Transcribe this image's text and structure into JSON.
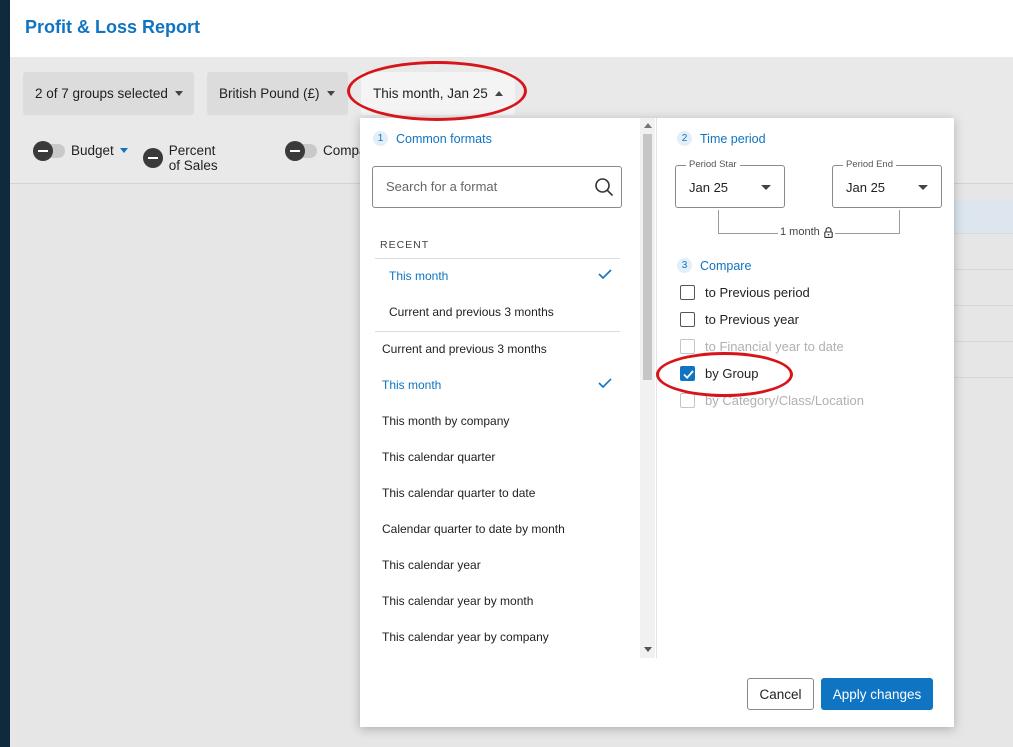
{
  "header": {
    "title": "Profit & Loss Report"
  },
  "filters": {
    "groups": "2 of 7 groups selected",
    "currency": "British Pound (£)",
    "period": "This month, Jan 25"
  },
  "toggles": [
    {
      "label": "Budget"
    },
    {
      "label": "Percent of Sales"
    },
    {
      "label": "Compa"
    }
  ],
  "panel": {
    "common_formats": {
      "number": "1",
      "title": "Common formats"
    },
    "search_placeholder": "Search for a format",
    "recent_label": "RECENT",
    "recent_items": [
      {
        "label": "This month",
        "selected": true
      },
      {
        "label": "Current and previous 3 months",
        "selected": false
      }
    ],
    "items": [
      {
        "label": "Current and previous 3 months",
        "selected": false
      },
      {
        "label": "This month",
        "selected": true
      },
      {
        "label": "This month by company",
        "selected": false
      },
      {
        "label": "This calendar quarter",
        "selected": false
      },
      {
        "label": "This calendar quarter to date",
        "selected": false
      },
      {
        "label": "Calendar quarter to date by month",
        "selected": false
      },
      {
        "label": "This calendar year",
        "selected": false
      },
      {
        "label": "This calendar year by month",
        "selected": false
      },
      {
        "label": "This calendar year by company",
        "selected": false
      }
    ],
    "time_period": {
      "number": "2",
      "title": "Time period",
      "start_label": "Period Star",
      "start_value": "Jan 25",
      "end_label": "Period End",
      "end_value": "Jan 25",
      "duration": "1 month"
    },
    "compare": {
      "number": "3",
      "title": "Compare",
      "options": [
        {
          "label": "to Previous period",
          "checked": false,
          "disabled": false
        },
        {
          "label": "to Previous year",
          "checked": false,
          "disabled": false
        },
        {
          "label": "to Financial year to date",
          "checked": false,
          "disabled": true
        },
        {
          "label": "by Group",
          "checked": true,
          "disabled": false
        },
        {
          "label": "by Category/Class/Location",
          "checked": false,
          "disabled": true
        }
      ]
    },
    "buttons": {
      "cancel": "Cancel",
      "apply": "Apply changes"
    }
  },
  "colors": {
    "accent": "#0f74c2",
    "annotation": "#d8141b",
    "rail": "#0f2a3d"
  }
}
